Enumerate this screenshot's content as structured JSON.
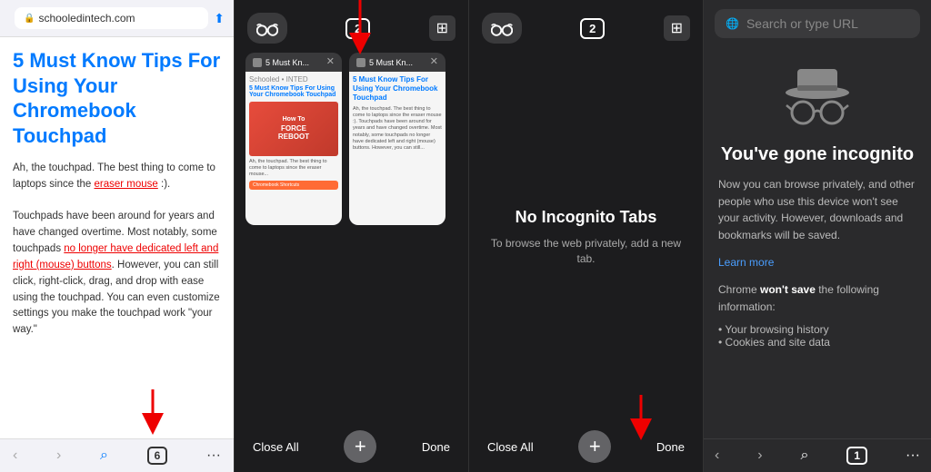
{
  "browser": {
    "url": "schooledintech.com",
    "article": {
      "title": "5 Must Know Tips For Using Your Chromebook Touchpad",
      "body_parts": [
        "Ah, the touchpad. The best thing to come to laptops since the ",
        "eraser mouse",
        " :).\nTouchpads have been around for years and have changed overtime. Most notably, some touchpads ",
        "no longer have dedicated left and right (mouse) buttons",
        ". However, you can still click, right-click, drag, and drop with ease using the touchpad. You can even customize settings you make the touchpad work \"your way.\""
      ]
    },
    "tab_count": "6",
    "bottom_nav": {
      "back": "‹",
      "forward": "›",
      "search": "⌕",
      "tabs": "6",
      "more": "···"
    }
  },
  "tabs_panel": {
    "icons": {
      "incognito": "👓",
      "tabs_count": "2",
      "new_tab": "⊞"
    },
    "tabs": [
      {
        "title": "5 Must Kn...",
        "preview_title": "5 Must Know Tips For Using Your Chromebook Touchpad"
      },
      {
        "title": "5 Must Kn...",
        "preview_title": "5 Must Know Tips For Using Your Chromebook Touchpad"
      }
    ],
    "bottom": {
      "close_all": "Close All",
      "done": "Done",
      "add": "+"
    }
  },
  "incognito_tabs": {
    "icons": {
      "incognito": "👓",
      "tabs_count": "2",
      "new_tab": "⊞"
    },
    "empty_title": "No Incognito Tabs",
    "empty_subtitle": "To browse the web privately, add a new tab.",
    "bottom": {
      "close_all": "Close All",
      "done": "Done",
      "add": "+"
    }
  },
  "incognito_info": {
    "search_placeholder": "Search or type URL",
    "heading": "You've gone incognito",
    "description": "Now you can browse privately, and other people who use this device won't see your activity. However, downloads and bookmarks will be saved.",
    "learn_more": "Learn more",
    "wont_save_prefix": "Chrome ",
    "wont_save_bold": "won't save",
    "wont_save_suffix": " the following information:",
    "list_items": [
      "Your browsing history",
      "Cookies and site data"
    ],
    "bottom": {
      "back": "‹",
      "forward": "›",
      "search_icon": "⌕",
      "tab_count": "1",
      "more": "···"
    }
  }
}
